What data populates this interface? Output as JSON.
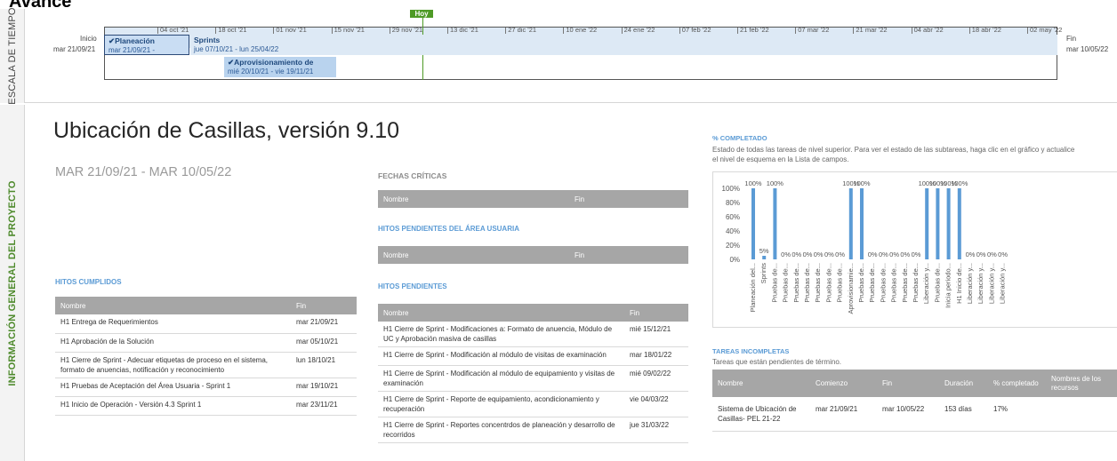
{
  "page_title": "Avance",
  "timeline": {
    "side_label": "ESCALA DE TIEMPO",
    "start_label": "Inicio",
    "start_date": "mar 21/09/21",
    "end_label": "Fin",
    "end_date": "mar 10/05/22",
    "today_label": "Hoy",
    "ticks": [
      "04 oct '21",
      "18 oct '21",
      "01 nov '21",
      "15 nov '21",
      "29 nov '21",
      "13 dic '21",
      "27 dic '21",
      "10 ene '22",
      "24 ene '22",
      "07 feb '22",
      "21 feb '22",
      "07 mar '22",
      "21 mar '22",
      "04 abr '22",
      "18 abr '22",
      "02 may '22"
    ],
    "bars": [
      {
        "name": "✔Planeación",
        "dates": "mar 21/09/21 -"
      },
      {
        "name": "Sprints",
        "dates": "jue 07/10/21 - lun 25/04/22"
      },
      {
        "name": "✔Aprovisionamiento de",
        "dates": "mié 20/10/21 - vie 19/11/21"
      }
    ]
  },
  "info": {
    "side_label": "INFORMACIÓN GENERAL DEL PROYECTO",
    "project_title": "Ubicación de Casillas, versión 9.10",
    "project_dates": "MAR 21/09/21 - MAR 10/05/22"
  },
  "fechas_criticas": {
    "title": "FECHAS CRÍTICAS",
    "headers": [
      "Nombre",
      "Fin"
    ]
  },
  "hitos_area_usuaria": {
    "title": "HITOS PENDIENTES DEL ÁREA USUARIA",
    "headers": [
      "Nombre",
      "Fin"
    ]
  },
  "hitos_cumplidos": {
    "title": "HITOS CUMPLIDOS",
    "headers": [
      "Nombre",
      "Fin"
    ],
    "rows": [
      [
        "H1 Entrega de Requerimientos",
        "mar 21/09/21"
      ],
      [
        "H1 Aprobación de la Solución",
        "mar 05/10/21"
      ],
      [
        "H1 Cierre de Sprint - Adecuar etiquetas de proceso en el sistema, formato de anuencias, notificación y reconocimiento",
        "lun 18/10/21"
      ],
      [
        "H1 Pruebas de Aceptación del Área Usuaria - Sprint 1",
        "mar 19/10/21"
      ],
      [
        "H1 Inicio de Operación - Versión 4.3 Sprint 1",
        "mar 23/11/21"
      ]
    ]
  },
  "hitos_pendientes": {
    "title": "HITOS PENDIENTES",
    "headers": [
      "Nombre",
      "Fin"
    ],
    "rows": [
      [
        "H1 Cierre de Sprint - Modificaciones a: Formato de anuencia, Módulo de UC y Aprobación masiva de casillas",
        "mié 15/12/21"
      ],
      [
        "H1 Cierre de Sprint - Modificación al módulo de visitas de examinación",
        "mar 18/01/22"
      ],
      [
        "H1 Cierre de Sprint - Modificación al módulo de equipamiento y visitas de examinación",
        "mié 09/02/22"
      ],
      [
        "H1 Cierre de Sprint - Reporte de equipamiento, acondicionamiento y recuperación",
        "vie 04/03/22"
      ],
      [
        "H1 Cierre de Sprint - Reportes concentrdos de planeación y desarrollo de recorridos",
        "jue 31/03/22"
      ]
    ]
  },
  "completado": {
    "title": "% COMPLETADO",
    "description": "Estado de todas las tareas de nivel superior. Para ver el estado de las subtareas, haga clic en el gráfico y actualice el nivel de esquema en la Lista de campos."
  },
  "chart_data": {
    "type": "bar",
    "categories": [
      "Planeación del...",
      "Sprints",
      "Pruebas de...",
      "Pruebas de...",
      "Pruebas de...",
      "Pruebas de...",
      "Pruebas de...",
      "Pruebas de...",
      "Pruebas de...",
      "Aprovisionamie...",
      "Pruebas de...",
      "Pruebas de...",
      "Pruebas de...",
      "Pruebas de...",
      "Pruebas de...",
      "Pruebas de...",
      "Liberación y...",
      "Pruebas de...",
      "Inicia periodo...",
      "H1 Inicio de...",
      "Liberación y...",
      "Liberación y...",
      "Liberación y...",
      "Liberación y..."
    ],
    "values": [
      100,
      5,
      100,
      0,
      0,
      0,
      0,
      0,
      0,
      100,
      100,
      0,
      0,
      0,
      0,
      0,
      100,
      100,
      100,
      100,
      0,
      0,
      0,
      0
    ],
    "ylim": [
      0,
      100
    ],
    "yticks": [
      "100%",
      "80%",
      "60%",
      "40%",
      "20%",
      "0%"
    ],
    "bar_color": "#5b9bd5"
  },
  "tareas_incompletas": {
    "title": "TAREAS INCOMPLETAS",
    "description": "Tareas que están pendientes de término.",
    "headers": [
      "Nombre",
      "Comienzo",
      "Fin",
      "Duración",
      "% completado",
      "Nombres de los recursos"
    ],
    "rows": [
      [
        "Sistema de Ubicación de Casillas- PEL 21-22",
        "mar 21/09/21",
        "mar 10/05/22",
        "153 días",
        "17%",
        ""
      ]
    ]
  }
}
